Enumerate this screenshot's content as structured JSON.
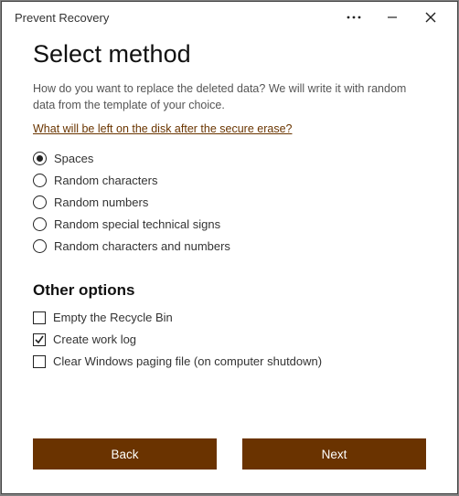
{
  "window": {
    "title": "Prevent Recovery"
  },
  "page": {
    "heading": "Select method",
    "intro": "How do you want to replace the deleted data? We will write it with random data from the template of your choice.",
    "link": "What will be left on the disk after the secure erase?"
  },
  "methods": {
    "options": [
      {
        "label": "Spaces",
        "selected": true
      },
      {
        "label": "Random characters",
        "selected": false
      },
      {
        "label": "Random numbers",
        "selected": false
      },
      {
        "label": "Random special technical signs",
        "selected": false
      },
      {
        "label": "Random characters and numbers",
        "selected": false
      }
    ]
  },
  "other": {
    "heading": "Other options",
    "items": [
      {
        "label": "Empty the Recycle Bin",
        "checked": false
      },
      {
        "label": "Create work log",
        "checked": true
      },
      {
        "label": "Clear Windows paging file (on computer shutdown)",
        "checked": false
      }
    ]
  },
  "footer": {
    "back": "Back",
    "next": "Next"
  }
}
